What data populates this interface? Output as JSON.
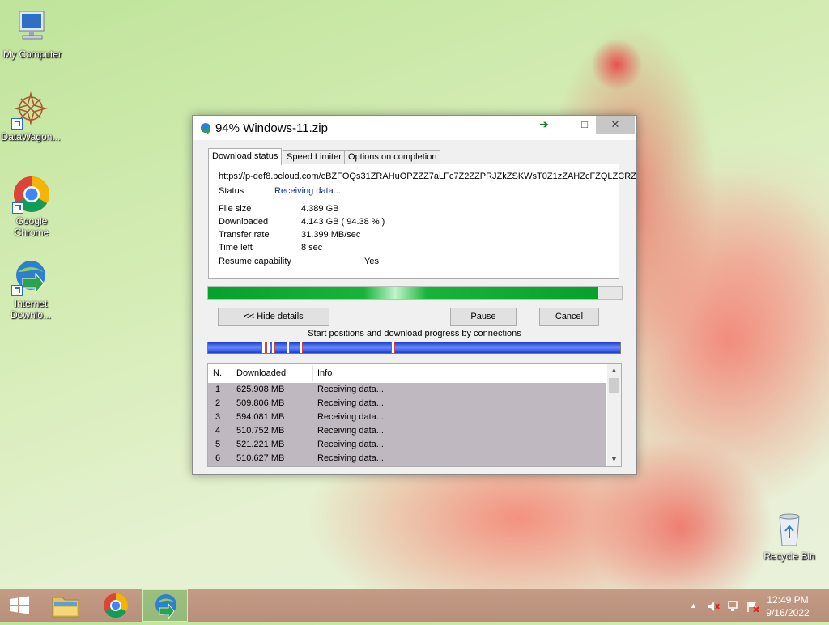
{
  "desktop": {
    "icons": [
      {
        "label": "My Computer"
      },
      {
        "label": "DataWagon..."
      },
      {
        "label": "Google Chrome"
      },
      {
        "label": "Internet Downlo..."
      },
      {
        "label": "Recycle Bin"
      }
    ]
  },
  "window": {
    "title": "94% Windows-11.zip",
    "tabs": [
      {
        "label": "Download status"
      },
      {
        "label": "Speed Limiter"
      },
      {
        "label": "Options on completion"
      }
    ],
    "url": "https://p-def8.pcloud.com/cBZFOQs31ZRAHuOPZZZ7aLFc7Z2ZZPRJZkZSKWsT0Z1zZAHZcFZQLZCRZ",
    "status": {
      "label": "Status",
      "value": "Receiving data..."
    },
    "details": [
      {
        "label": "File size",
        "value": "4.389  GB"
      },
      {
        "label": "Downloaded",
        "value": "4.143  GB  ( 94.38 % )"
      },
      {
        "label": "Transfer rate",
        "value": "31.399  MB/sec"
      },
      {
        "label": "Time left",
        "value": "8 sec"
      }
    ],
    "resume": {
      "label": "Resume capability",
      "value": "Yes"
    },
    "progress_percent": 94.38,
    "buttons": {
      "hide_details": "<< Hide details",
      "pause": "Pause",
      "cancel": "Cancel"
    },
    "connections_caption": "Start positions and download progress by connections",
    "connections_table": {
      "columns": [
        "N.",
        "Downloaded",
        "Info"
      ],
      "rows": [
        {
          "n": "1",
          "downloaded": "625.908  MB",
          "info": "Receiving data..."
        },
        {
          "n": "2",
          "downloaded": "509.806  MB",
          "info": "Receiving data..."
        },
        {
          "n": "3",
          "downloaded": "594.081  MB",
          "info": "Receiving data..."
        },
        {
          "n": "4",
          "downloaded": "510.752  MB",
          "info": "Receiving data..."
        },
        {
          "n": "5",
          "downloaded": "521.221  MB",
          "info": "Receiving data..."
        },
        {
          "n": "6",
          "downloaded": "510.627  MB",
          "info": "Receiving data..."
        }
      ]
    }
  },
  "taskbar": {
    "time": "12:49 PM",
    "date": "9/16/2022",
    "items": [
      "start-icon",
      "file-explorer-icon",
      "chrome-icon",
      "idm-icon"
    ]
  },
  "colors": {
    "progress_green": "#06a12a",
    "connection_blue": "#1a3ecb",
    "status_blue": "#0a2a9c"
  }
}
